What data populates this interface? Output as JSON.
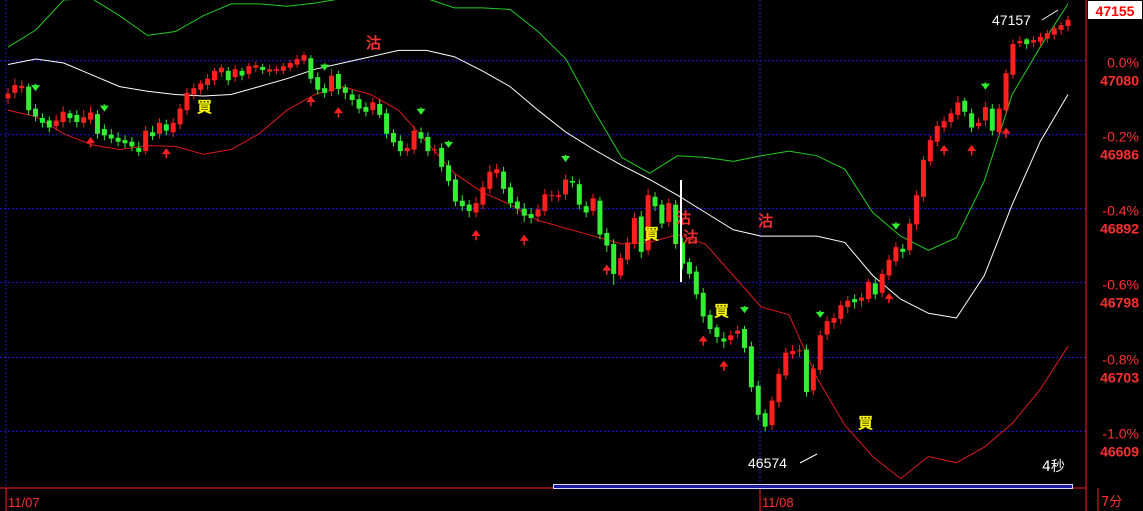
{
  "chart_data": {
    "type": "candlestick",
    "interval": "7分",
    "refresh": "4秒",
    "last_price": "47155",
    "x_tick_labels": [
      "11/07",
      "11/08"
    ],
    "right_axis": [
      {
        "pct": "0.0%",
        "price": "47080"
      },
      {
        "pct": "-0.2%",
        "price": "46986"
      },
      {
        "pct": "-0.4%",
        "price": "46892"
      },
      {
        "pct": "-0.6%",
        "price": "46798"
      },
      {
        "pct": "-0.8%",
        "price": "46703"
      },
      {
        "pct": "-1.0%",
        "price": "46609"
      }
    ],
    "ylim": [
      46560,
      47180
    ],
    "annotations": {
      "high": "47157",
      "low": "46574"
    },
    "signal_labels": {
      "buy": "買",
      "sell": "沽"
    },
    "colors": {
      "up": "#ff2020",
      "down": "#33ee33",
      "mid_band": "#ffffff",
      "lower_band": "#dd1a1a",
      "upper_band": "#22cc22",
      "grid": "#1c1cc8",
      "buy_text": "#ffff00",
      "sell_text": "#ff3030"
    },
    "candles_o": [
      47055,
      47062,
      47068,
      47070,
      47042,
      47030,
      47027,
      47020,
      47025,
      47036,
      47034,
      47024,
      47028,
      47035,
      47016,
      47009,
      47005,
      47002,
      47000,
      46992,
      46988,
      47012,
      47010,
      47022,
      47012,
      47022,
      47040,
      47060,
      47066,
      47072,
      47078,
      47088,
      47090,
      47082,
      47090,
      47086,
      47094,
      47095,
      47089,
      47090,
      47090,
      47094,
      47098,
      47103,
      47106,
      47082,
      47068,
      47064,
      47086,
      47069,
      47060,
      47054,
      47044,
      47040,
      47048,
      47036,
      47011,
      47001,
      46988,
      46990,
      47012,
      47006,
      46990,
      46992,
      46970,
      46952,
      46925,
      46920,
      46910,
      46920,
      46940,
      46960,
      46962,
      46942,
      46924,
      46915,
      46908,
      46905,
      46912,
      46931,
      46930,
      46933,
      46950,
      46946,
      46918,
      46912,
      46925,
      46884,
      46870,
      46830,
      46850,
      46870,
      46905,
      46862,
      46930,
      46920,
      46898,
      46920,
      46872,
      46847,
      46835,
      46808,
      46780,
      46764,
      46750,
      46748,
      46756,
      46762,
      46740,
      46690,
      46655,
      46640,
      46669,
      46703,
      46730,
      46735,
      46736,
      46684,
      46710,
      46755,
      46770,
      46775,
      46790,
      46800,
      46798,
      46800,
      46820,
      46808,
      46830,
      46848,
      46864,
      46862,
      46895,
      46930,
      46975,
      47000,
      47018,
      47025,
      47034,
      47052,
      47036,
      47020,
      47027,
      47042,
      47012,
      47040,
      47085,
      47125,
      47130,
      47126,
      47127,
      47131,
      47136,
      47142,
      47147
    ],
    "candles_c": [
      47061,
      47072,
      47071,
      47040,
      47032,
      47024,
      47018,
      47027,
      47038,
      47030,
      47025,
      47031,
      47037,
      47010,
      47008,
      47004,
      47000,
      46998,
      46994,
      46987,
      47014,
      47007,
      47024,
      47014,
      47024,
      47042,
      47062,
      47068,
      47074,
      47080,
      47090,
      47094,
      47078,
      47092,
      47084,
      47096,
      47097,
      47091,
      47092,
      47092,
      47096,
      47100,
      47105,
      47110,
      47080,
      47066,
      47062,
      47084,
      47067,
      47062,
      47053,
      47042,
      47038,
      47050,
      47034,
      47010,
      46999,
      46988,
      46992,
      47014,
      47004,
      46988,
      46990,
      46968,
      46950,
      46924,
      46918,
      46912,
      46922,
      46942,
      46962,
      46965,
      46940,
      46922,
      46915,
      46906,
      46903,
      46914,
      46933,
      46932,
      46932,
      46952,
      46948,
      46920,
      46910,
      46928,
      46882,
      46868,
      46832,
      46852,
      46872,
      46903,
      46860,
      46932,
      46918,
      46896,
      46922,
      46870,
      46845,
      46832,
      46806,
      46778,
      46762,
      46752,
      46746,
      46754,
      46760,
      46738,
      46688,
      46653,
      46638,
      46671,
      46705,
      46732,
      46734,
      46735,
      46682,
      46712,
      46754,
      46772,
      46776,
      46792,
      46798,
      46796,
      46802,
      46822,
      46806,
      46832,
      46850,
      46866,
      46860,
      46896,
      46932,
      46977,
      47002,
      47020,
      47026,
      47036,
      47050,
      47038,
      47018,
      47024,
      47044,
      47014,
      47042,
      47087,
      47124,
      47128,
      47124,
      47129,
      47133,
      47138,
      47144,
      47148,
      47155
    ],
    "candles_h": [
      47068,
      47080,
      47078,
      47074,
      47048,
      47036,
      47032,
      47034,
      47045,
      47040,
      47040,
      47040,
      47045,
      47040,
      47022,
      47016,
      47012,
      47008,
      47006,
      47000,
      47020,
      47020,
      47030,
      47028,
      47030,
      47048,
      47068,
      47074,
      47078,
      47086,
      47094,
      47098,
      47095,
      47097,
      47094,
      47100,
      47102,
      47099,
      47098,
      47096,
      47100,
      47104,
      47110,
      47114,
      47110,
      47088,
      47074,
      47092,
      47090,
      47073,
      47066,
      47060,
      47050,
      47056,
      47054,
      47042,
      47016,
      47008,
      46998,
      47020,
      47018,
      47012,
      46996,
      46998,
      46976,
      46958,
      46932,
      46926,
      46930,
      46950,
      46970,
      46972,
      46968,
      46948,
      46930,
      46922,
      46916,
      46920,
      46940,
      46938,
      46938,
      46958,
      46956,
      46952,
      46924,
      46934,
      46930,
      46890,
      46876,
      46858,
      46878,
      46910,
      46912,
      46940,
      46936,
      46926,
      46928,
      46926,
      46878,
      46852,
      46842,
      46814,
      46786,
      46768,
      46758,
      46760,
      46766,
      46766,
      46746,
      46696,
      46660,
      46676,
      46712,
      46738,
      46742,
      46742,
      46742,
      46718,
      46760,
      46778,
      46782,
      46798,
      46804,
      46806,
      46808,
      46826,
      46826,
      46838,
      46856,
      46872,
      46870,
      46902,
      46938,
      46982,
      47008,
      47026,
      47032,
      47042,
      47058,
      47056,
      47042,
      47030,
      47050,
      47048,
      47048,
      47092,
      47130,
      47134,
      47132,
      47134,
      47138,
      47142,
      47148,
      47152,
      47160
    ],
    "candles_l": [
      47048,
      47055,
      47062,
      47034,
      47026,
      47018,
      47012,
      47014,
      47018,
      47024,
      47018,
      47018,
      47022,
      47004,
      47002,
      46998,
      46994,
      46992,
      46988,
      46982,
      46984,
      47002,
      47004,
      47008,
      47006,
      47016,
      47034,
      47054,
      47060,
      47066,
      47072,
      47082,
      47072,
      47076,
      47078,
      47080,
      47088,
      47086,
      47084,
      47086,
      47086,
      47090,
      47094,
      47098,
      47074,
      47060,
      47056,
      47058,
      47060,
      47054,
      47046,
      47036,
      47032,
      47034,
      47030,
      47004,
      46994,
      46982,
      46982,
      46984,
      46998,
      46982,
      46984,
      46962,
      46944,
      46918,
      46912,
      46904,
      46904,
      46914,
      46934,
      46954,
      46934,
      46916,
      46908,
      46898,
      46896,
      46898,
      46906,
      46924,
      46924,
      46926,
      46942,
      46914,
      46904,
      46906,
      46876,
      46860,
      46818,
      46826,
      46844,
      46864,
      46852,
      46856,
      46912,
      46890,
      46892,
      46864,
      46838,
      46826,
      46800,
      46770,
      46756,
      46744,
      46738,
      46742,
      46750,
      46732,
      46682,
      46646,
      46632,
      46634,
      46662,
      46698,
      46724,
      46726,
      46676,
      46678,
      46704,
      46748,
      46762,
      46768,
      46782,
      46788,
      46790,
      46796,
      46800,
      46802,
      46824,
      46842,
      46852,
      46856,
      46888,
      46924,
      46970,
      46994,
      47012,
      47018,
      47028,
      47032,
      47012,
      47016,
      47020,
      47008,
      47006,
      47034,
      47080,
      47120,
      47118,
      47120,
      47122,
      47126,
      47130,
      47136,
      47140
    ],
    "bands": {
      "mid": [
        47098,
        47105,
        47100,
        47085,
        47070,
        47064,
        47060,
        47058,
        47060,
        47070,
        47080,
        47092,
        47100,
        47108,
        47116,
        47116,
        47108,
        47090,
        47070,
        47040,
        47012,
        46990,
        46970,
        46952,
        46932,
        46910,
        46888,
        46880,
        46880,
        46880,
        46872,
        46830,
        46800,
        46782,
        46776,
        46830,
        46920,
        47000,
        47060
      ],
      "upper": [
        47120,
        47142,
        47180,
        47182,
        47160,
        47135,
        47140,
        47160,
        47175,
        47175,
        47172,
        47176,
        47182,
        47186,
        47188,
        47182,
        47170,
        47170,
        47168,
        47140,
        47105,
        47040,
        46980,
        46960,
        46982,
        46980,
        46975,
        46982,
        46988,
        46982,
        46965,
        46910,
        46880,
        46862,
        46878,
        46950,
        47060,
        47120,
        47175
      ],
      "lower": [
        47040,
        47032,
        47010,
        46996,
        46990,
        46995,
        46994,
        46984,
        46990,
        47010,
        47040,
        47060,
        47070,
        47060,
        47040,
        47000,
        46960,
        46936,
        46920,
        46900,
        46890,
        46880,
        46870,
        46872,
        46882,
        46870,
        46830,
        46790,
        46780,
        46700,
        46640,
        46600,
        46572,
        46600,
        46592,
        46612,
        46642,
        46685,
        46740
      ]
    }
  }
}
